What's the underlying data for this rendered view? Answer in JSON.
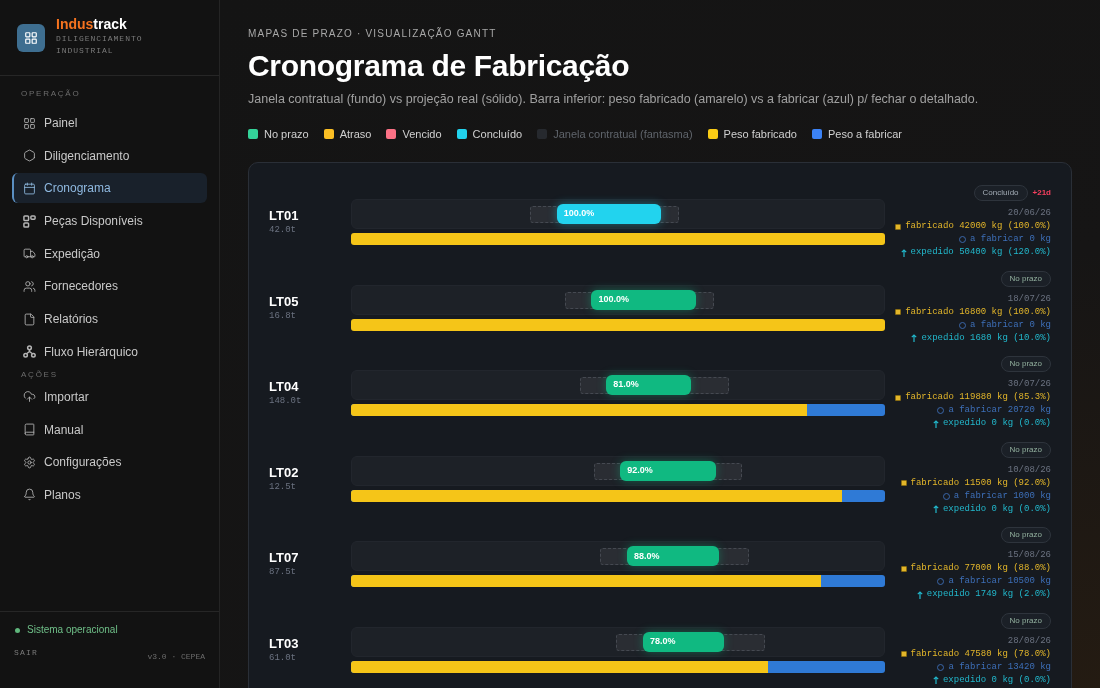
{
  "sidebar": {
    "brand": {
      "name_accent": "Indus",
      "name_rest": "track",
      "subtitle": "DILIGENCIAMENTO INDUSTRIAL"
    },
    "sections": [
      {
        "title": "OPERAÇÃO",
        "items": [
          {
            "label": "Painel",
            "selected": false
          },
          {
            "label": "Diligenciamento",
            "selected": false
          },
          {
            "label": "Cronograma",
            "selected": true
          },
          {
            "label": "Peças Disponíveis",
            "selected": false
          },
          {
            "label": "Expedição",
            "selected": false
          },
          {
            "label": "Fornecedores",
            "selected": false
          },
          {
            "label": "Relatórios",
            "selected": false
          },
          {
            "label": "Fluxo Hierárquico",
            "selected": false
          }
        ]
      },
      {
        "title": "AÇÕES",
        "items": [
          {
            "label": "Importar",
            "selected": false
          },
          {
            "label": "Manual",
            "selected": false
          },
          {
            "label": "Configurações",
            "selected": false
          },
          {
            "label": "Planos",
            "selected": false
          }
        ]
      }
    ],
    "status": "Sistema operacional",
    "logout": "SAIR",
    "version": "v3.0 · CEPEA"
  },
  "header": {
    "eyebrow": "MAPAS DE PRAZO · VISUALIZAÇÃO GANTT",
    "title": "Cronograma de Fabricação",
    "subtitle": "Janela contratual (fundo) vs projeção real (sólido). Barra inferior: peso fabricado (amarelo) vs a fabricar (azul) p/ fechar o detalhado."
  },
  "legend": [
    {
      "label": "No prazo",
      "color": "#34d399",
      "kind": "solid"
    },
    {
      "label": "Atraso",
      "color": "#fbbf24",
      "kind": "solid"
    },
    {
      "label": "Vencido",
      "color": "#fb7185",
      "kind": "solid"
    },
    {
      "label": "Concluído",
      "color": "#22d3ee",
      "kind": "solid"
    },
    {
      "label": "Janela contratual (fantasma)",
      "color": "#26292e",
      "kind": "ghost"
    },
    {
      "label": "Peso fabricado",
      "color": "#facc15",
      "kind": "solid"
    },
    {
      "label": "Peso a fabricar",
      "color": "#3b82f6",
      "kind": "solid"
    }
  ],
  "lots": [
    {
      "code": "LT01",
      "weight": "42.0t",
      "progress": {
        "label": "100.0%",
        "color": "#22d3ee"
      },
      "production": {
        "level": 1.0
      },
      "status": {
        "label": "Concluído",
        "kind": "done"
      },
      "delay": "+21d",
      "date": "20/06/26",
      "fabricated": "fabricado 42000 kg (100.0%)",
      "to_fabricate": "a fabricar 0 kg",
      "shipped": "expedido 50400 kg (120.0%)"
    },
    {
      "code": "LT05",
      "weight": "16.8t",
      "progress": {
        "label": "100.0%",
        "color": "#10b981"
      },
      "production": {
        "level": 1.0
      },
      "status": {
        "label": "No prazo",
        "kind": "on_time"
      },
      "date": "18/07/26",
      "fabricated": "fabricado 16800 kg (100.0%)",
      "to_fabricate": "a fabricar 0 kg",
      "shipped": "expedido 1680 kg (10.0%)"
    },
    {
      "code": "LT04",
      "weight": "148.0t",
      "progress": {
        "label": "81.0%",
        "color": "#10b981"
      },
      "production": {
        "level": 0.853
      },
      "status": {
        "label": "No prazo",
        "kind": "on_time"
      },
      "date": "30/07/26",
      "fabricated": "fabricado 119880 kg (85.3%)",
      "to_fabricate": "a fabricar 20720 kg",
      "shipped": "expedido 0 kg (0.0%)"
    },
    {
      "code": "LT02",
      "weight": "12.5t",
      "progress": {
        "label": "92.0%",
        "color": "#10b981"
      },
      "production": {
        "level": 0.92
      },
      "status": {
        "label": "No prazo",
        "kind": "on_time"
      },
      "date": "10/08/26",
      "fabricated": "fabricado 11500 kg (92.0%)",
      "to_fabricate": "a fabricar 1000 kg",
      "shipped": "expedido 0 kg (0.0%)"
    },
    {
      "code": "LT07",
      "weight": "87.5t",
      "progress": {
        "label": "88.0%",
        "color": "#10b981"
      },
      "production": {
        "level": 0.88
      },
      "status": {
        "label": "No prazo",
        "kind": "on_time"
      },
      "date": "15/08/26",
      "fabricated": "fabricado 77000 kg (88.0%)",
      "to_fabricate": "a fabricar 10500 kg",
      "shipped": "expedido 1749 kg (2.0%)"
    },
    {
      "code": "LT03",
      "weight": "61.0t",
      "progress": {
        "label": "78.0%",
        "color": "#10b981"
      },
      "production": {
        "level": 0.78
      },
      "status": {
        "label": "No prazo",
        "kind": "on_time"
      },
      "date": "28/08/26",
      "fabricated": "fabricado 47580 kg (78.0%)",
      "to_fabricate": "a fabricar 13420 kg",
      "shipped": "expedido 0 kg (0.0%)"
    }
  ]
}
